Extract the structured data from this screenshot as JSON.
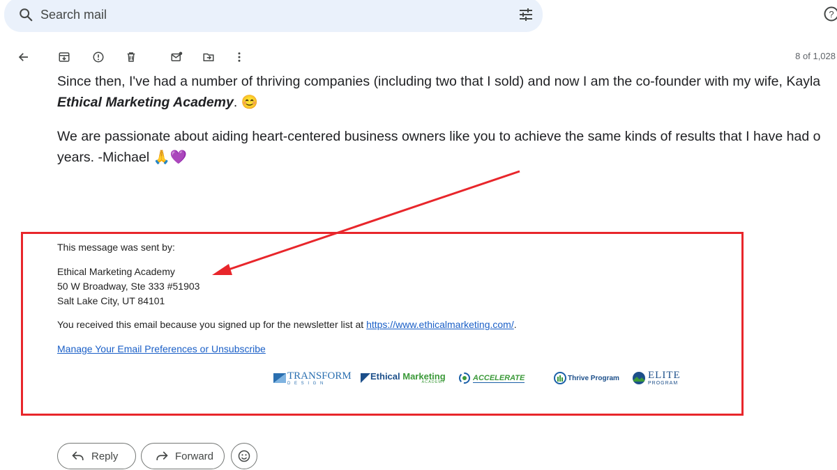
{
  "search": {
    "placeholder": "Search mail"
  },
  "toolbar": {
    "counter": "8 of 1,028"
  },
  "message": {
    "para1_line1": "Since then, I've had a number of thriving companies (including two that I sold) and now I am the co-founder with my wife, Kayla",
    "para1_emphasis": "Ethical Marketing Academy",
    "para1_end": ".",
    "para1_emoji": "😊",
    "para2_line1": "We are passionate about aiding heart-centered business owners like you to achieve the same kinds of results that I have had o",
    "para2_line2": "years. -Michael",
    "para2_emoji": "🙏💜"
  },
  "footer": {
    "sent_by": "This message was sent by:",
    "company": "Ethical Marketing Academy",
    "address1": "50 W Broadway, Ste 333 #51903",
    "address2": "Salt Lake City, UT 84101",
    "reason": "You received this email because you signed up for the newsletter list at ",
    "reason_link": "https://www.ethicalmarketing.com/",
    "reason_end": ".",
    "manage_link": "Manage Your Email Preferences or Unsubscribe"
  },
  "logos": {
    "transform_main": "TRANSFORM",
    "transform_sub": "D E S I G N",
    "ethical_a": "Ethical",
    "ethical_b": "Marketing",
    "ethical_sub": "ACADEMY",
    "accelerate": "ACCELERATE",
    "thrive": "Thrive Program",
    "elite_main": "ELITE",
    "elite_sub": "PROGRAM"
  },
  "actions": {
    "reply": "Reply",
    "forward": "Forward"
  },
  "colors": {
    "highlight": "#e8262b",
    "link": "#1a5fc7",
    "search_bg": "#eaf1fb"
  }
}
